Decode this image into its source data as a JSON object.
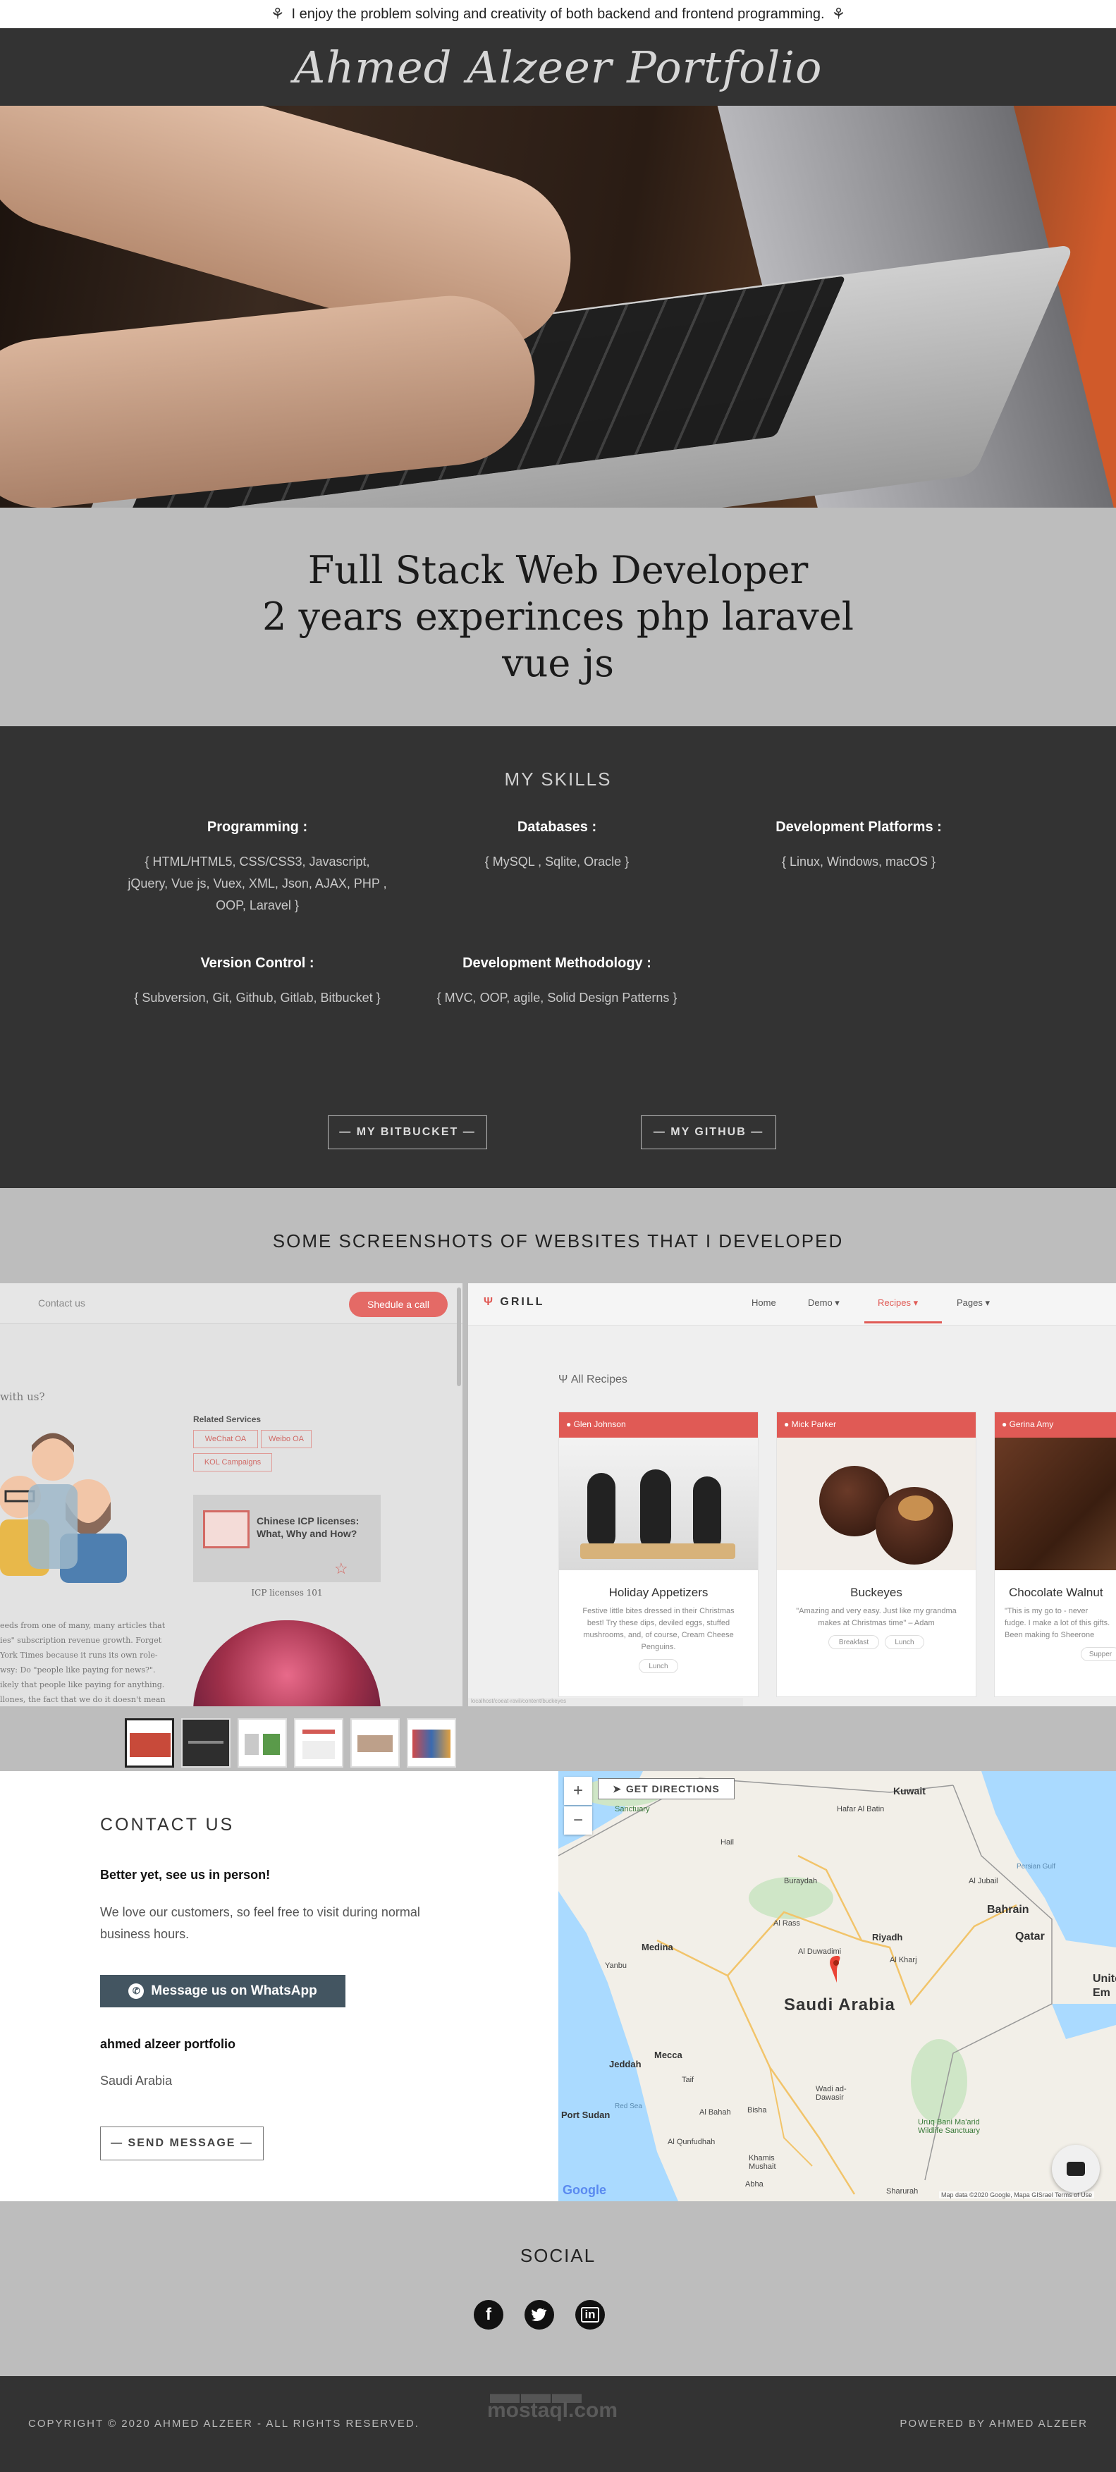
{
  "announcement": {
    "text": "I enjoy the problem solving and creativity of both backend and frontend programming."
  },
  "header": {
    "brand": "Ahmed Alzeer Portfolio"
  },
  "intro": {
    "line1": "Full Stack Web Developer",
    "line2": "2 years experinces php laravel",
    "line3": "vue js"
  },
  "skills": {
    "title": "MY SKILLS",
    "groups": [
      {
        "title": "Programming :",
        "items": "{ HTML/HTML5, CSS/CSS3, Javascript, jQuery, Vue js, Vuex, XML, Json, AJAX, PHP , OOP, Laravel }"
      },
      {
        "title": "Databases :",
        "items": "{ MySQL , Sqlite, Oracle }"
      },
      {
        "title": "Development Platforms :",
        "items": "{ Linux, Windows, macOS }"
      },
      {
        "title": "Version Control :",
        "items": "{ Subversion, Git, Github, Gitlab, Bitbucket }"
      },
      {
        "title": "Development Methodology :",
        "items": "{ MVC, OOP, agile, Solid Design Patterns }"
      }
    ],
    "bitbucket_label": "— MY BITBUCKET —",
    "github_label": "— MY GITHUB —"
  },
  "screenshots": {
    "title": "SOME SCREENSHOTS OF WEBSITES THAT I DEVELOPED",
    "left": {
      "nav_link": "Contact us",
      "cta": "Shedule a call",
      "question": "with us?",
      "related_title": "Related Services",
      "tags": [
        "WeChat OA",
        "Weibo OA",
        "KOL Campaigns"
      ],
      "card_title": "Chinese ICP licenses: What, Why and How?",
      "card_caption": "ICP licenses 101",
      "body": "eeds from one of many, many articles that ies\" subscription revenue growth. Forget York Times because it runs its own role- wsy: Do \"people like paying for news?\". ikely that people like paying for anything. llones, the fact that we do it doesn't mean"
    },
    "right": {
      "logo": "GRILL",
      "nav": [
        "Home",
        "Demo",
        "Recipes",
        "Pages"
      ],
      "section": "All Recipes",
      "recipes": [
        {
          "author": "Glen Johnson",
          "title": "Holiday Appetizers",
          "desc": "Festive little bites dressed in their Christmas best! Try these dips, deviled eggs, stuffed mushrooms, and, of course, Cream Cheese Penguins.",
          "tags": [
            "Lunch"
          ]
        },
        {
          "author": "Mick Parker",
          "title": "Buckeyes",
          "desc": "\"Amazing and very easy. Just like my grandma makes at Christmas time\" – Adam",
          "tags": [
            "Breakfast",
            "Lunch"
          ]
        },
        {
          "author": "Gerina Amy",
          "title": "Chocolate Walnut",
          "desc": "\"This is my go to - never fudge. I make a lot of this gifts. Been making fo Sheerone",
          "tags": [
            "Supper"
          ]
        }
      ],
      "status_url": "localhost/coeat-ravil/content/buckeyes"
    },
    "thumb_count": 6
  },
  "contact": {
    "title": "CONTACT US",
    "subtitle": "Better yet, see us in person!",
    "text": "We love our customers, so feel free to visit during normal business hours.",
    "whatsapp_label": "Message us on WhatsApp",
    "company": "ahmed alzeer portfolio",
    "country": "Saudi Arabia",
    "send_label": "— SEND MESSAGE —"
  },
  "map": {
    "directions": "GET DIRECTIONS",
    "zoom_in": "+",
    "zoom_out": "−",
    "country_label": "Saudi Arabia",
    "cities": [
      {
        "name": "Kuwait"
      },
      {
        "name": "Hafar Al Batin"
      },
      {
        "name": "Hail"
      },
      {
        "name": "Buraydah"
      },
      {
        "name": "Al Jubail"
      },
      {
        "name": "Bahrain"
      },
      {
        "name": "Qatar"
      },
      {
        "name": "Riyadh"
      },
      {
        "name": "Medina"
      },
      {
        "name": "Yanbu"
      },
      {
        "name": "Jeddah"
      },
      {
        "name": "Mecca"
      },
      {
        "name": "Taif"
      },
      {
        "name": "Port Sudan"
      },
      {
        "name": "Khamis Mushait"
      },
      {
        "name": "Abha"
      },
      {
        "name": "Al Kharj"
      },
      {
        "name": "Al Duwadimi"
      },
      {
        "name": "Al Rass"
      },
      {
        "name": "Unite Em"
      },
      {
        "name": "Wadi ad-Dawasir"
      },
      {
        "name": "Bisha"
      },
      {
        "name": "Al Bahah"
      },
      {
        "name": "Al Qunfudhah"
      },
      {
        "name": "Sharurah"
      }
    ],
    "sanctuary1": "Sanctuary",
    "sanctuary2": "Uruq Bani Ma'arid Wildlife Sanctuary",
    "persian_gulf": "Persian Gulf",
    "red_sea": "Red Sea",
    "google": "Google",
    "attribution": "Map data ©2020 Google, Mapa GISrael  Terms of Use"
  },
  "social": {
    "title": "SOCIAL",
    "icons": [
      "facebook-icon",
      "twitter-icon",
      "linkedin-icon"
    ]
  },
  "footer": {
    "copyright": "COPYRIGHT © 2020 AHMED ALZEER - ALL RIGHTS RESERVED.",
    "powered": "POWERED BY AHMED ALZEER",
    "watermark": "mostaql.com"
  },
  "colors": {
    "dark": "#333333",
    "grey": "#bdbdbd",
    "accent_red": "#e05a55",
    "whatsapp_btn": "#435561"
  }
}
